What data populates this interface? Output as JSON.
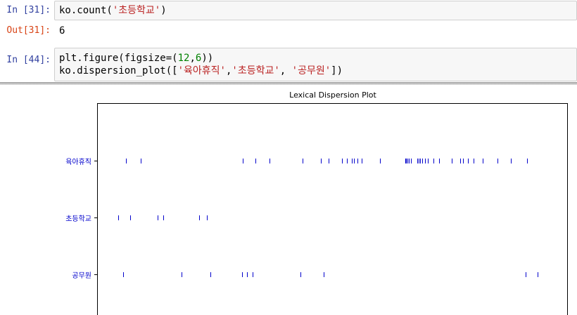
{
  "cells": [
    {
      "prompt": "In [31]:",
      "code": [
        "ko.count(",
        "'초등학교'",
        ")"
      ]
    },
    {
      "prompt": "Out[31]:",
      "output": "6"
    },
    {
      "prompt": "In [44]:",
      "line1": [
        "plt.figure(figsize=(",
        "12",
        ",",
        "6",
        "))"
      ],
      "line2": [
        "ko.dispersion_plot([",
        "'육아휴직'",
        ",",
        "'초등학교'",
        ", ",
        "'공무원'",
        "])"
      ]
    }
  ],
  "chart_data": {
    "type": "scatter",
    "title": "Lexical Dispersion Plot",
    "words": [
      "육아휴직",
      "초등학교",
      "공무원"
    ],
    "xlim": [
      0,
      1000
    ],
    "series": [
      {
        "name": "육아휴직",
        "x": [
          62,
          93,
          310,
          337,
          366,
          437,
          475,
          492,
          520,
          530,
          541,
          545,
          553,
          562,
          601,
          654,
          656,
          659,
          662,
          667,
          680,
          683,
          686,
          691,
          696,
          702,
          714,
          726,
          753,
          771,
          777,
          787,
          799,
          819,
          851,
          879,
          913
        ]
      },
      {
        "name": "초등학교",
        "x": [
          45,
          70,
          128,
          140,
          216,
          233
        ]
      },
      {
        "name": "공무원",
        "x": [
          55,
          179,
          240,
          308,
          319,
          330,
          432,
          481,
          911,
          936
        ]
      }
    ],
    "colors": {
      "marker": "#0000cc",
      "axis": "#000000"
    }
  }
}
